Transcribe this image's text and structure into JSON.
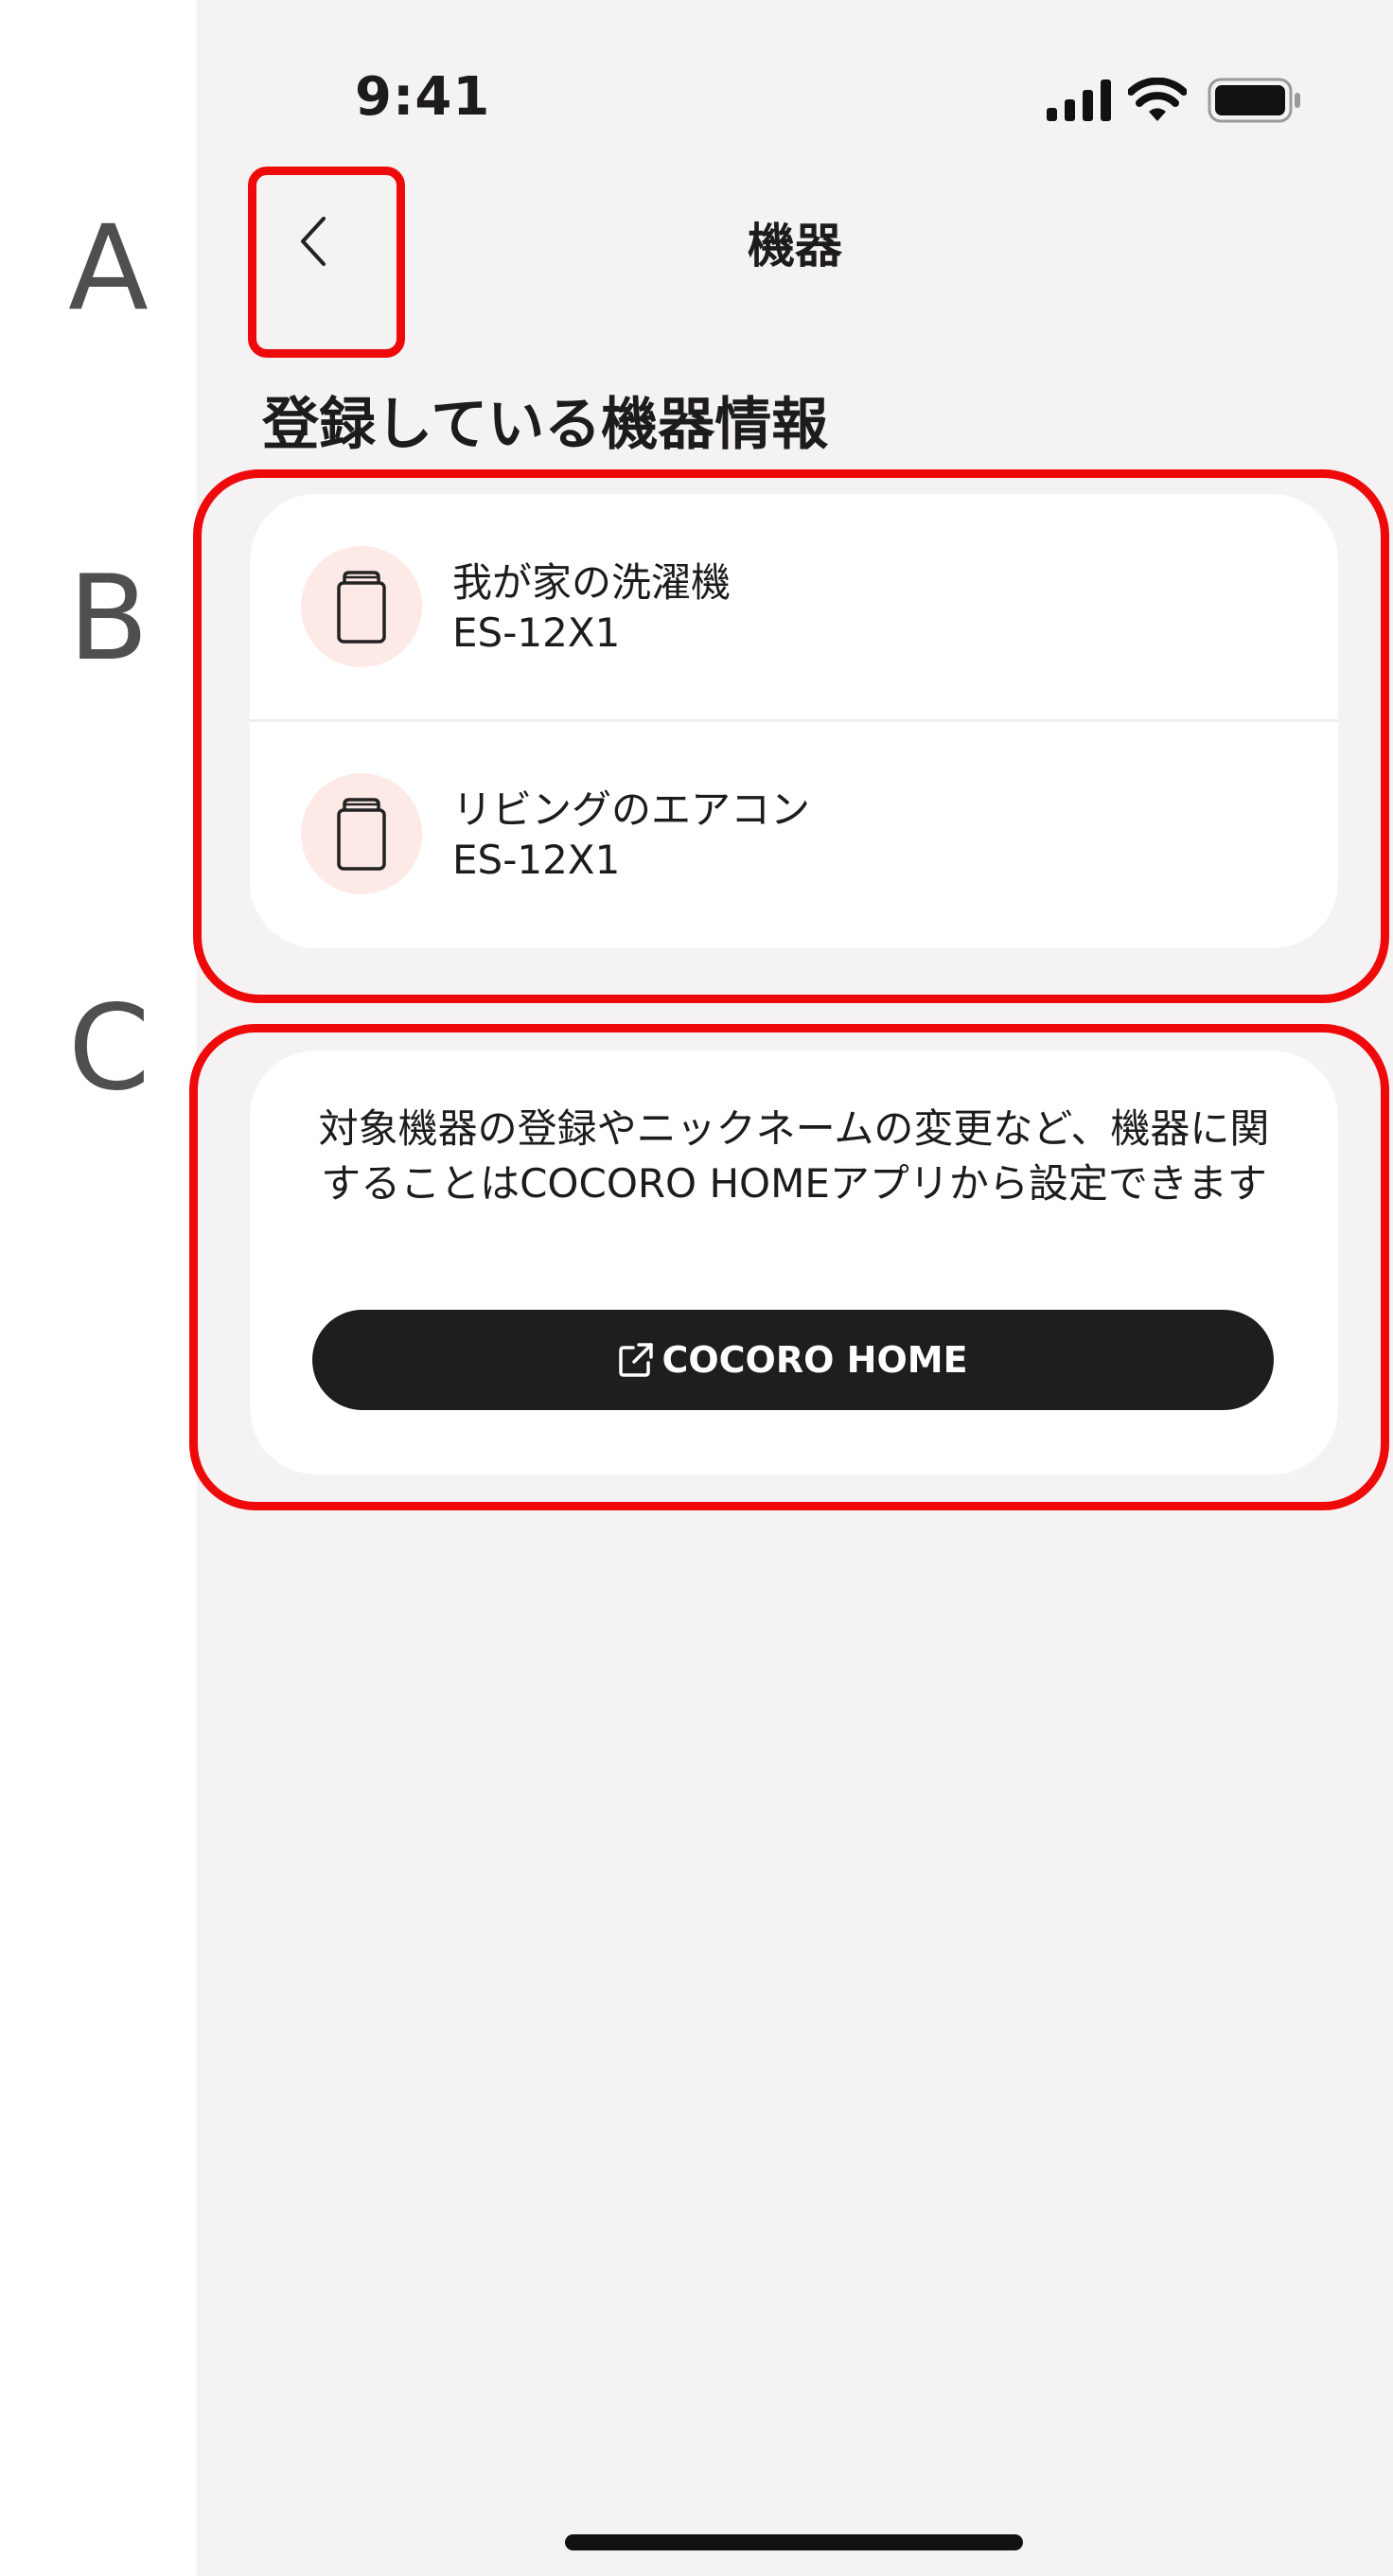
{
  "annotations": {
    "a": "A",
    "b": "B",
    "c": "C",
    "box_color": "#ee0a0a"
  },
  "status_bar": {
    "time": "9:41",
    "icons": [
      "signal-icon",
      "wifi-icon",
      "battery-icon"
    ]
  },
  "header": {
    "back_icon": "chevron-left-icon",
    "title": "機器"
  },
  "section": {
    "title": "登録している機器情報"
  },
  "devices": [
    {
      "name": "我が家の洗濯機",
      "model": "ES-12X1",
      "icon": "appliance-icon"
    },
    {
      "name": "リビングのエアコン",
      "model": "ES-12X1",
      "icon": "appliance-icon"
    }
  ],
  "info": {
    "text": "対象機器の登録やニックネームの変更など、機器に関することはCOCORO HOMEアプリから設定できます",
    "button_label": "COCORO HOME",
    "button_icon": "external-link-icon"
  },
  "colors": {
    "background": "#f5f2f3",
    "card": "#ffffff",
    "icon_circle": "#fde9e5",
    "button": "#1f1d1e",
    "annotation": "#ee0a0a"
  }
}
